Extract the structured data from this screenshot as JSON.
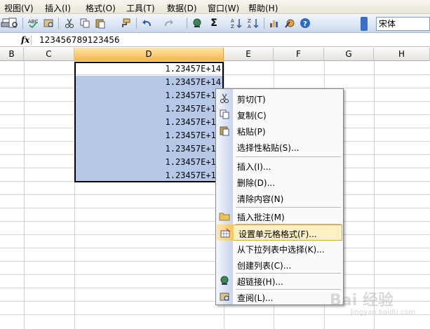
{
  "menubar": {
    "items": [
      "视图(V)",
      "插入(I)",
      "格式(O)",
      "工具(T)",
      "数据(D)",
      "窗口(W)",
      "帮助(H)"
    ]
  },
  "toolbar": {
    "font_name": "宋体"
  },
  "formula_bar": {
    "fx_label": "fx",
    "value": "123456789123456"
  },
  "sheet": {
    "columns": [
      "B",
      "C",
      "D",
      "E",
      "F",
      "G",
      "H"
    ],
    "active_column": "D",
    "cells": [
      "1.23457E+14",
      "1.23457E+14",
      "1.23457E+14",
      "1.23457E+14",
      "1.23457E+14",
      "1.23457E+14",
      "1.23457E+14",
      "1.23457E+14",
      "1.23457E+14"
    ]
  },
  "context_menu": {
    "items": [
      {
        "label": "剪切(T)",
        "icon": "scissors-icon"
      },
      {
        "label": "复制(C)",
        "icon": "copy-icon"
      },
      {
        "label": "粘贴(P)",
        "icon": "paste-icon"
      },
      {
        "label": "选择性粘贴(S)...",
        "icon": ""
      },
      {
        "label": "插入(I)...",
        "icon": ""
      },
      {
        "label": "删除(D)...",
        "icon": ""
      },
      {
        "label": "清除内容(N)",
        "icon": ""
      },
      {
        "label": "插入批注(M)",
        "icon": "folder-icon"
      },
      {
        "label": "设置单元格格式(F)...",
        "icon": "format-cells-icon"
      },
      {
        "label": "从下拉列表中选择(K)...",
        "icon": ""
      },
      {
        "label": "创建列表(C)...",
        "icon": ""
      },
      {
        "label": "超链接(H)...",
        "icon": "hyperlink-icon"
      },
      {
        "label": "查阅(L)...",
        "icon": "research-icon"
      }
    ],
    "highlighted_index": 8
  },
  "watermark": {
    "text": "Bai 经验",
    "sub": "jingyan.baidu.com"
  },
  "colors": {
    "selection": "#b6c8e8",
    "active_header": "#f8b24a",
    "menu_hover": "#fdf0c2"
  }
}
